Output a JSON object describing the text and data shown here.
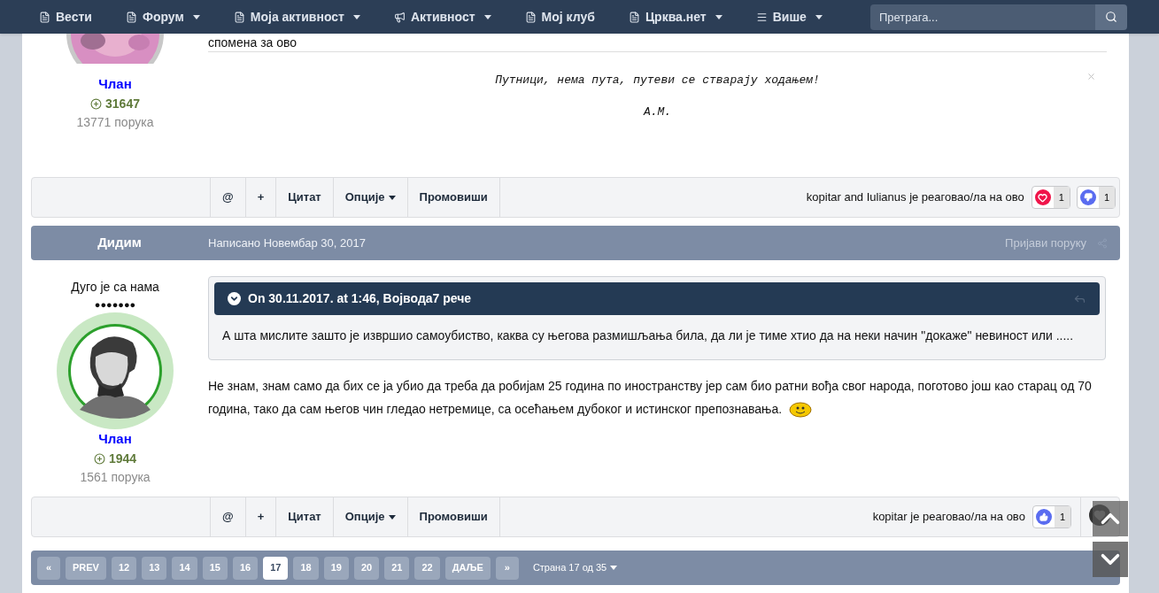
{
  "nav": {
    "items": [
      {
        "label": "Вести",
        "dropdown": false
      },
      {
        "label": "Форум",
        "dropdown": true
      },
      {
        "label": "Моја активност",
        "dropdown": true
      },
      {
        "label": "Активност",
        "dropdown": true
      },
      {
        "label": "Мој клуб",
        "dropdown": false
      },
      {
        "label": "Црква.нет",
        "dropdown": true
      },
      {
        "label": "Више",
        "dropdown": true
      }
    ],
    "search": {
      "placeholder": "Претрага..."
    }
  },
  "post_1": {
    "author": {
      "role": "Члан",
      "reputation": "31647",
      "post_count": "13771 порука"
    },
    "text": "спомена за ово",
    "signature": [
      "Путници, нема пута, путеви се стварају ходањем!",
      "А.М."
    ],
    "actions": [
      {
        "label": "@",
        "dropdown": false
      },
      {
        "label": "+",
        "dropdown": false
      },
      {
        "label": "Цитат",
        "dropdown": false
      },
      {
        "label": "Опције",
        "dropdown": true
      },
      {
        "label": "Промовиши",
        "dropdown": false
      }
    ],
    "reacted_text": "kopitar and Iulianus је реаговао/ла на ово",
    "reactions": [
      {
        "kind": "love",
        "count": "1"
      },
      {
        "kind": "dislike",
        "count": "1"
      }
    ]
  },
  "post_2": {
    "header": {
      "author": "Дидим",
      "date": "Написано Новембар 30, 2017",
      "report": "Пријави поруку"
    },
    "author": {
      "rank": "Дуго је са нама",
      "pips": "●●●●●●●",
      "role": "Члан",
      "reputation": "1944",
      "post_count": "1561 порука"
    },
    "quote": {
      "title": "On 30.11.2017. at 1:46, Војвода7 рече",
      "text": "А шта мислите зашто је извршио самоубиство, каква су његова размишљања била, да ли је тиме хтио да на неки начин \"докаже\" невиност или ....."
    },
    "text": "Не знам, знам само да бих се ја убио да треба да робијам 25 година по иностранству јер сам био ратни вођа свог народа, поготово још као старац од 70 година, тако да сам његов чин гледао нетремице, са осећањем дубоког и истинског препознавања.",
    "actions": [
      {
        "label": "@",
        "dropdown": false
      },
      {
        "label": "+",
        "dropdown": false
      },
      {
        "label": "Цитат",
        "dropdown": false
      },
      {
        "label": "Опције",
        "dropdown": true
      },
      {
        "label": "Промовиши",
        "dropdown": false
      }
    ],
    "reacted_text": "kopitar је реаговао/ла на ово",
    "reactions": [
      {
        "kind": "like",
        "count": "1"
      }
    ]
  },
  "pagination": {
    "pages": [
      {
        "label": "«",
        "selected": false
      },
      {
        "label": "PREV",
        "selected": false
      },
      {
        "label": "12",
        "selected": false
      },
      {
        "label": "13",
        "selected": false
      },
      {
        "label": "14",
        "selected": false
      },
      {
        "label": "15",
        "selected": false
      },
      {
        "label": "16",
        "selected": false
      },
      {
        "label": "17",
        "selected": true
      },
      {
        "label": "18",
        "selected": false
      },
      {
        "label": "19",
        "selected": false
      },
      {
        "label": "20",
        "selected": false
      },
      {
        "label": "21",
        "selected": false
      },
      {
        "label": "22",
        "selected": false
      },
      {
        "label": "ДАЉЕ",
        "selected": false
      },
      {
        "label": "»",
        "selected": false
      }
    ],
    "page_of": "Страна 17 од 35"
  }
}
